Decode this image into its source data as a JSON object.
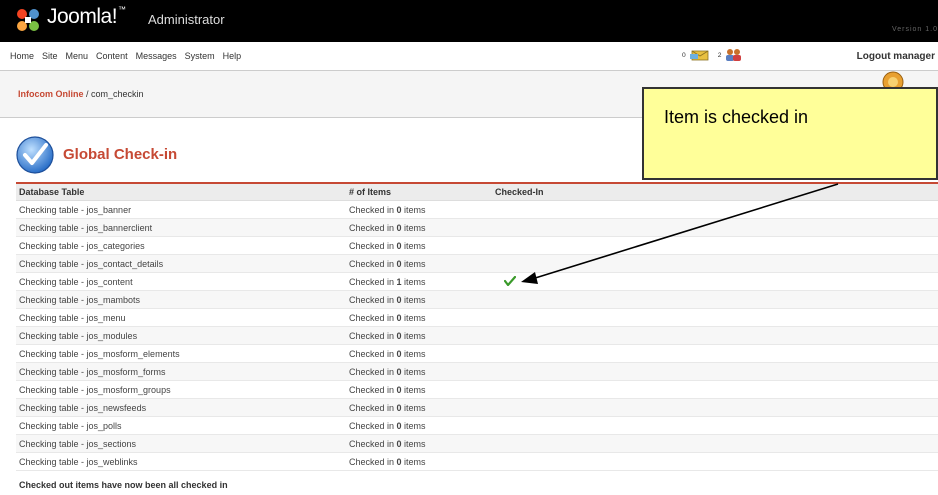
{
  "header": {
    "logo_text": "Joomla!",
    "logo_tm": "™",
    "admin_label": "Administrator",
    "version": "Version 1.0"
  },
  "menu": {
    "items": [
      "Home",
      "Site",
      "Menu",
      "Content",
      "Messages",
      "System",
      "Help"
    ],
    "messages_count": "0",
    "users_count": "2",
    "logout": "Logout manager"
  },
  "breadcrumb": {
    "site": "Infocom Online",
    "separator": " / ",
    "component": "com_checkin"
  },
  "page": {
    "title": "Global Check-in"
  },
  "table": {
    "headers": [
      "Database Table",
      "# of Items",
      "Checked-In"
    ],
    "rows": [
      {
        "table": "Checking table - jos_banner",
        "prefix": "Checked in ",
        "count": "0",
        "suffix": " items",
        "checked": false
      },
      {
        "table": "Checking table - jos_bannerclient",
        "prefix": "Checked in ",
        "count": "0",
        "suffix": " items",
        "checked": false
      },
      {
        "table": "Checking table - jos_categories",
        "prefix": "Checked in ",
        "count": "0",
        "suffix": " items",
        "checked": false
      },
      {
        "table": "Checking table - jos_contact_details",
        "prefix": "Checked in ",
        "count": "0",
        "suffix": " items",
        "checked": false
      },
      {
        "table": "Checking table - jos_content",
        "prefix": "Checked in ",
        "count": "1",
        "suffix": " items",
        "checked": true
      },
      {
        "table": "Checking table - jos_mambots",
        "prefix": "Checked in ",
        "count": "0",
        "suffix": " items",
        "checked": false
      },
      {
        "table": "Checking table - jos_menu",
        "prefix": "Checked in ",
        "count": "0",
        "suffix": " items",
        "checked": false
      },
      {
        "table": "Checking table - jos_modules",
        "prefix": "Checked in ",
        "count": "0",
        "suffix": " items",
        "checked": false
      },
      {
        "table": "Checking table - jos_mosform_elements",
        "prefix": "Checked in ",
        "count": "0",
        "suffix": " items",
        "checked": false
      },
      {
        "table": "Checking table - jos_mosform_forms",
        "prefix": "Checked in ",
        "count": "0",
        "suffix": " items",
        "checked": false
      },
      {
        "table": "Checking table - jos_mosform_groups",
        "prefix": "Checked in ",
        "count": "0",
        "suffix": " items",
        "checked": false
      },
      {
        "table": "Checking table - jos_newsfeeds",
        "prefix": "Checked in ",
        "count": "0",
        "suffix": " items",
        "checked": false
      },
      {
        "table": "Checking table - jos_polls",
        "prefix": "Checked in ",
        "count": "0",
        "suffix": " items",
        "checked": false
      },
      {
        "table": "Checking table - jos_sections",
        "prefix": "Checked in ",
        "count": "0",
        "suffix": " items",
        "checked": false
      },
      {
        "table": "Checking table - jos_weblinks",
        "prefix": "Checked in ",
        "count": "0",
        "suffix": " items",
        "checked": false
      }
    ],
    "footer_note": "Checked out items have now been all checked in"
  },
  "callout": {
    "text": "Item is checked in"
  },
  "icons": {
    "logo": "joomla-logo-icon",
    "messages": "envelope-icon",
    "users": "users-icon",
    "help": "help-icon",
    "page": "checkmark-circle-icon",
    "checked": "green-check-icon"
  },
  "colors": {
    "brand_red": "#c64934",
    "callout_bg": "#ffff99",
    "check_green": "#3a9a2a"
  }
}
